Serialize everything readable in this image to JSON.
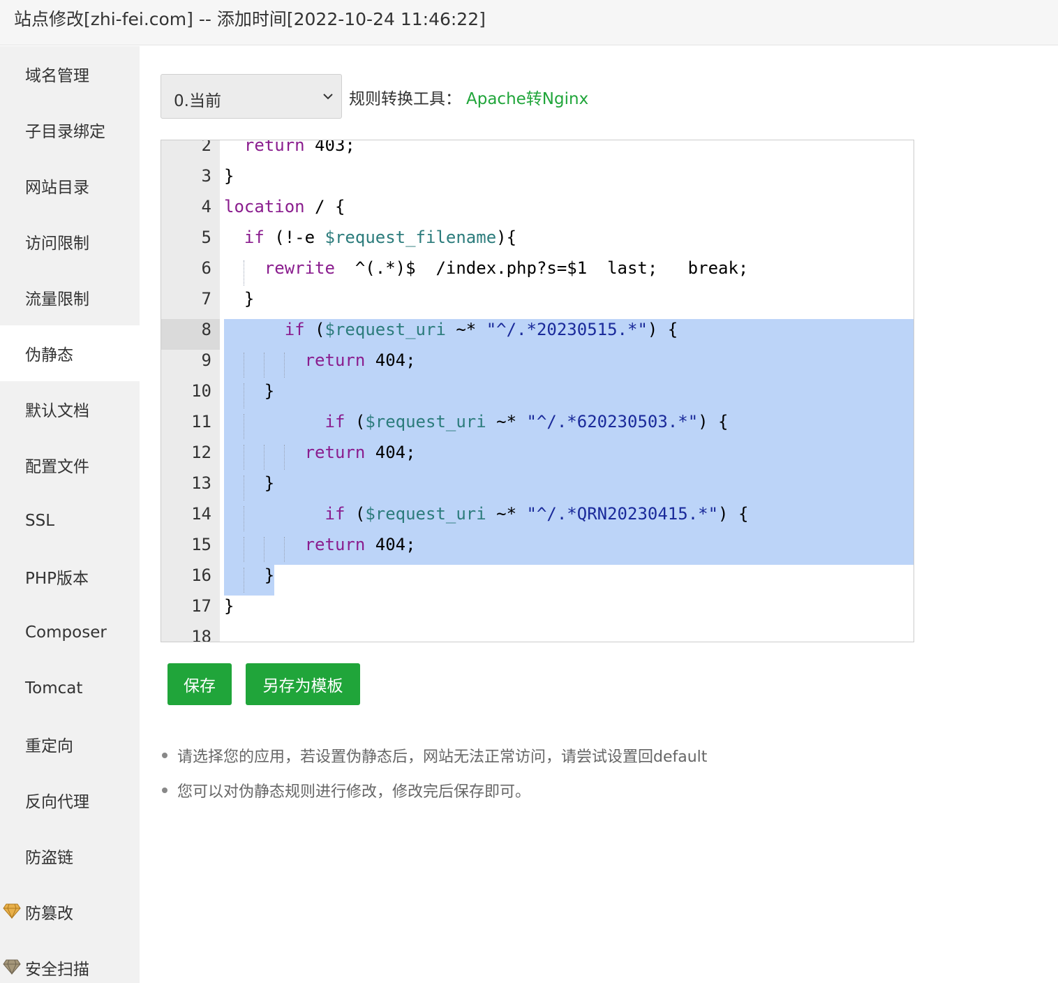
{
  "title": "站点修改[zhi-fei.com] -- 添加时间[2022-10-24 11:46:22]",
  "sidebar": {
    "items": [
      {
        "label": "域名管理"
      },
      {
        "label": "子目录绑定"
      },
      {
        "label": "网站目录"
      },
      {
        "label": "访问限制"
      },
      {
        "label": "流量限制"
      },
      {
        "label": "伪静态",
        "active": true
      },
      {
        "label": "默认文档"
      },
      {
        "label": "配置文件"
      },
      {
        "label": "SSL"
      },
      {
        "label": "PHP版本"
      },
      {
        "label": "Composer"
      },
      {
        "label": "Tomcat"
      },
      {
        "label": "重定向"
      },
      {
        "label": "反向代理"
      },
      {
        "label": "防盗链"
      },
      {
        "label": "防篡改",
        "icon": "diamond-icon"
      },
      {
        "label": "安全扫描",
        "icon": "diamond-icon"
      }
    ]
  },
  "toolbar": {
    "select_value": "0.当前",
    "tool_label": "规则转换工具：",
    "tool_link": "Apache转Nginx"
  },
  "editor": {
    "lines": [
      {
        "n": "2",
        "text": "  return 403;"
      },
      {
        "n": "3",
        "text": "}"
      },
      {
        "n": "4",
        "text": "location / {"
      },
      {
        "n": "5",
        "text": "  if (!-e $request_filename){"
      },
      {
        "n": "6",
        "text": "    rewrite  ^(.*)$  /index.php?s=$1  last;   break;"
      },
      {
        "n": "7",
        "text": "  }"
      },
      {
        "n": "8",
        "text": "      if ($request_uri ~* \"^/.*20230515.*\") {"
      },
      {
        "n": "9",
        "text": "        return 404;"
      },
      {
        "n": "10",
        "text": "    }"
      },
      {
        "n": "11",
        "text": "          if ($request_uri ~* \"^/.*620230503.*\") {"
      },
      {
        "n": "12",
        "text": "        return 404;"
      },
      {
        "n": "13",
        "text": "    }"
      },
      {
        "n": "14",
        "text": "          if ($request_uri ~* \"^/.*QRN20230415.*\") {"
      },
      {
        "n": "15",
        "text": "        return 404;"
      },
      {
        "n": "16",
        "text": "    }"
      },
      {
        "n": "17",
        "text": "}"
      },
      {
        "n": "18",
        "text": ""
      }
    ],
    "current_line": "8",
    "selection_color": "#bcd4f8"
  },
  "buttons": {
    "save": "保存",
    "save_template": "另存为模板"
  },
  "tips": [
    "请选择您的应用，若设置伪静态后，网站无法正常访问，请尝试设置回default",
    "您可以对伪静态规则进行修改，修改完后保存即可。"
  ],
  "colors": {
    "accent": "#20a53a",
    "keyword": "#8a1d8e",
    "variable": "#2c7c7c",
    "string": "#1a2a9a"
  }
}
